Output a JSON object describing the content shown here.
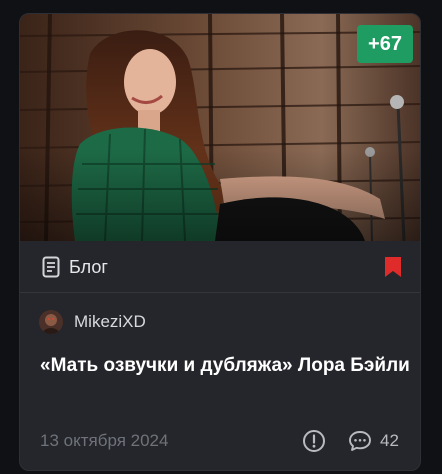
{
  "card": {
    "score": "+67",
    "category_label": "Блог",
    "author_name": "MikeziXD",
    "title": "«Мать озвучки и дубляжа» Лора Бэйли",
    "date": "13 октября 2024",
    "comments_count": "42"
  },
  "icons": {
    "category": "document-icon",
    "bookmark": "bookmark-icon",
    "report": "exclamation-circle-icon",
    "comments": "comment-bubble-icon"
  },
  "colors": {
    "score_badge": "#1e9c62",
    "bookmark": "#e02b2b",
    "card_bg": "#24262b"
  }
}
